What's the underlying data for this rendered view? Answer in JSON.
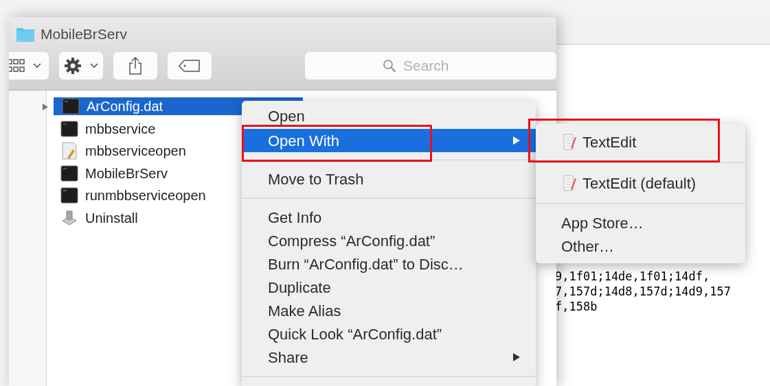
{
  "window": {
    "title": "MobileBrServ"
  },
  "toolbar": {
    "buttons": [
      {
        "kind": "view"
      },
      {
        "kind": "action"
      },
      {
        "kind": "share"
      },
      {
        "kind": "tags"
      }
    ],
    "search": {
      "placeholder": "Search"
    }
  },
  "files": [
    {
      "name": "ArConfig.dat",
      "kind": "terminal",
      "selected": true,
      "disclosure": true
    },
    {
      "name": "mbbservice",
      "kind": "terminal",
      "selected": false,
      "disclosure": false
    },
    {
      "name": "mbbserviceopen",
      "kind": "script",
      "selected": false,
      "disclosure": false
    },
    {
      "name": "MobileBrServ",
      "kind": "terminal",
      "selected": false,
      "disclosure": false
    },
    {
      "name": "runmbbserviceopen",
      "kind": "terminal",
      "selected": false,
      "disclosure": false
    },
    {
      "name": "Uninstall",
      "kind": "installer",
      "selected": false,
      "disclosure": false
    }
  ],
  "context_menu": {
    "items": [
      {
        "kind": "item",
        "label": "Open",
        "highlighted": false,
        "outlined": false,
        "submenu": false
      },
      {
        "kind": "item",
        "label": "Open With",
        "highlighted": true,
        "outlined": true,
        "submenu": true
      },
      {
        "kind": "separator"
      },
      {
        "kind": "item",
        "label": "Move to Trash",
        "highlighted": false,
        "outlined": false,
        "submenu": false
      },
      {
        "kind": "separator"
      },
      {
        "kind": "item",
        "label": "Get Info",
        "highlighted": false,
        "outlined": false,
        "submenu": false
      },
      {
        "kind": "item",
        "label": "Compress “ArConfig.dat”",
        "highlighted": false,
        "outlined": false,
        "submenu": false
      },
      {
        "kind": "item",
        "label": "Burn “ArConfig.dat” to Disc…",
        "highlighted": false,
        "outlined": false,
        "submenu": false
      },
      {
        "kind": "item",
        "label": "Duplicate",
        "highlighted": false,
        "outlined": false,
        "submenu": false
      },
      {
        "kind": "item",
        "label": "Make Alias",
        "highlighted": false,
        "outlined": false,
        "submenu": false
      },
      {
        "kind": "item",
        "label": "Quick Look “ArConfig.dat”",
        "highlighted": false,
        "outlined": false,
        "submenu": false
      },
      {
        "kind": "item",
        "label": "Share",
        "highlighted": false,
        "outlined": false,
        "submenu": true
      },
      {
        "kind": "separator"
      }
    ]
  },
  "open_with_submenu": {
    "items": [
      {
        "kind": "app",
        "label": "TextEdit",
        "outlined": true
      },
      {
        "kind": "separator"
      },
      {
        "kind": "app",
        "label": "TextEdit (default)",
        "outlined": false
      },
      {
        "kind": "separator"
      },
      {
        "kind": "item",
        "label": "App Store…",
        "outlined": false
      },
      {
        "kind": "item",
        "label": "Other…",
        "outlined": false
      }
    ]
  },
  "background_document": {
    "lines": [
      "9,1f01;14de,1f01;14df,",
      "7,157d;14d8,157d;14d9,157",
      "f,158b"
    ]
  }
}
